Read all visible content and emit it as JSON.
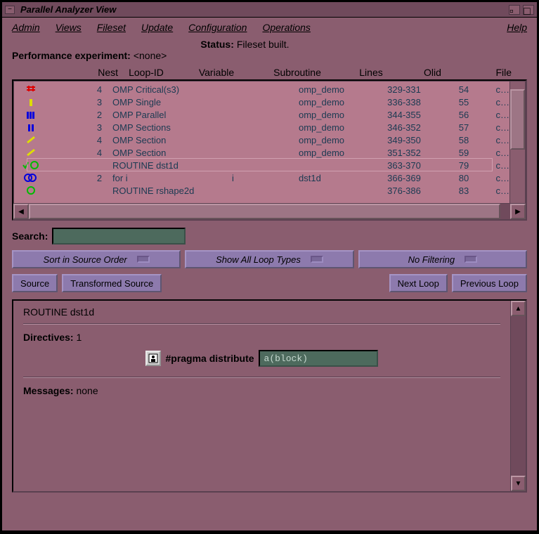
{
  "window": {
    "title": "Parallel Analyzer View"
  },
  "menubar": {
    "items": [
      "Admin",
      "Views",
      "Fileset",
      "Update",
      "Configuration",
      "Operations"
    ],
    "help": "Help"
  },
  "status": {
    "label": "Status:",
    "value": "Fileset built.",
    "perf_label": "Performance experiment:",
    "perf_value": "<none>"
  },
  "columns": [
    "Nest",
    "Loop-ID",
    "Variable",
    "Subroutine",
    "Lines",
    "Olid",
    "File"
  ],
  "rows": [
    {
      "icon": "red-bars",
      "nest": "4",
      "loopid": "  OMP Critical(s3)",
      "var": "",
      "subr": "omp_demo",
      "lines": "329-331",
      "olid": "54",
      "file": "c…"
    },
    {
      "icon": "yellow-bar",
      "nest": "3",
      "loopid": " OMP Single",
      "var": "",
      "subr": "omp_demo",
      "lines": "336-338",
      "olid": "55",
      "file": "c…"
    },
    {
      "icon": "blue-bars",
      "nest": "2",
      "loopid": "OMP Parallel",
      "var": "",
      "subr": "omp_demo",
      "lines": "344-355",
      "olid": "56",
      "file": "c…"
    },
    {
      "icon": "blue-pause",
      "nest": "3",
      "loopid": " OMP Sections",
      "var": "",
      "subr": "omp_demo",
      "lines": "346-352",
      "olid": "57",
      "file": "c…"
    },
    {
      "icon": "yellow-slash",
      "nest": "4",
      "loopid": "  OMP Section",
      "var": "",
      "subr": "omp_demo",
      "lines": "349-350",
      "olid": "58",
      "file": "c…"
    },
    {
      "icon": "yellow-slash",
      "nest": "4",
      "loopid": "  OMP Section",
      "var": "",
      "subr": "omp_demo",
      "lines": "351-352",
      "olid": "59",
      "file": "c…"
    },
    {
      "icon": "green-check-circle",
      "nest": "",
      "loopid": "ROUTINE dst1d",
      "var": "",
      "subr": "",
      "lines": "363-370",
      "olid": "79",
      "file": "c…",
      "selected": true
    },
    {
      "icon": "blue-circles",
      "nest": "2",
      "loopid": "for i",
      "var": "i",
      "subr": "dst1d",
      "lines": "366-369",
      "olid": "80",
      "file": "c…"
    },
    {
      "icon": "green-circle",
      "nest": "",
      "loopid": "ROUTINE rshape2d",
      "var": "",
      "subr": "",
      "lines": "376-386",
      "olid": "83",
      "file": "c…"
    }
  ],
  "search": {
    "label": "Search:",
    "value": ""
  },
  "dropdowns": {
    "sort": "Sort in Source Order",
    "loop": "Show All Loop Types",
    "filter": "No Filtering"
  },
  "buttons": {
    "source": "Source",
    "transformed": "Transformed Source",
    "next": "Next Loop",
    "prev": "Previous Loop"
  },
  "detail": {
    "title": "ROUTINE dst1d",
    "directives_label": "Directives:",
    "directives_count": "1",
    "pragma_label": "#pragma distribute",
    "pragma_value": "a(block)",
    "messages_label": "Messages:",
    "messages_value": "none"
  }
}
